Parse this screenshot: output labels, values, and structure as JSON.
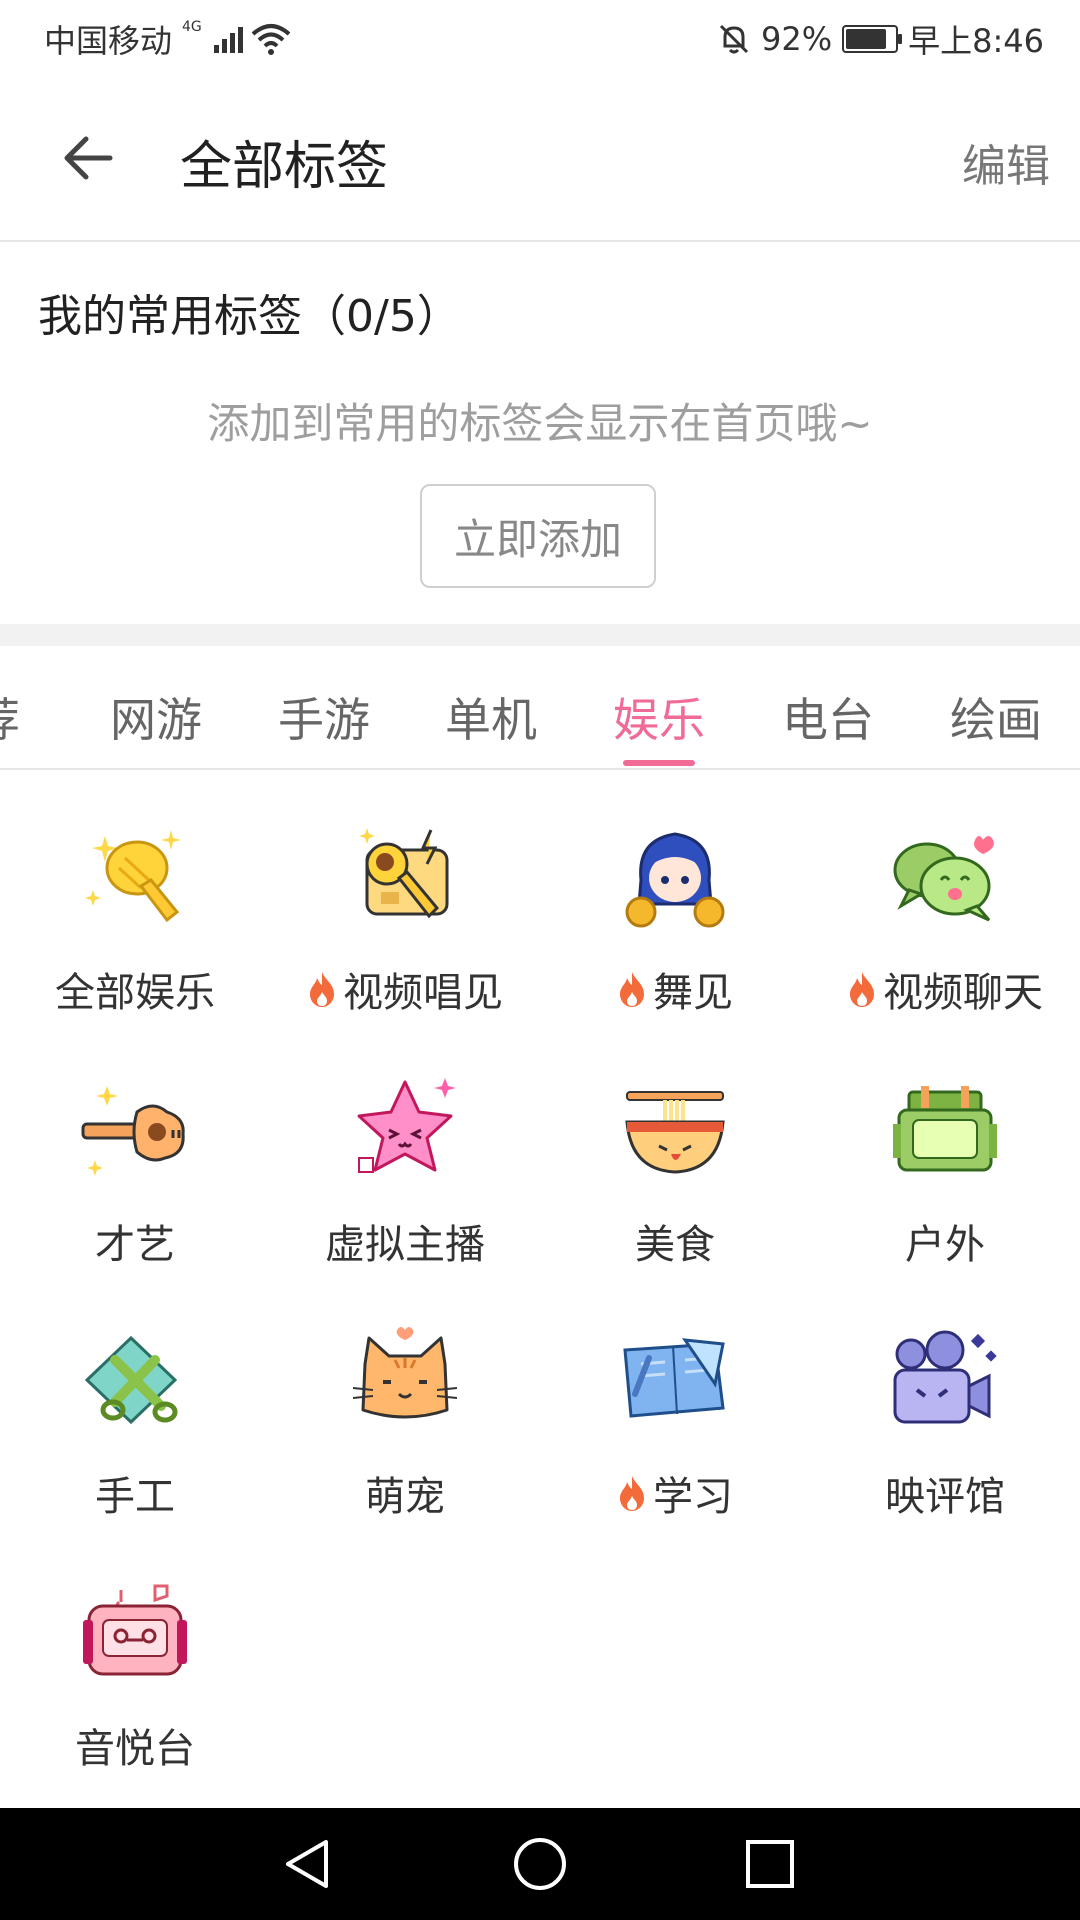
{
  "status_bar": {
    "carrier": "中国移动",
    "network": "4G",
    "battery": "92%",
    "battery_level": 0.92,
    "time": "早上8:46"
  },
  "header": {
    "title": "全部标签",
    "edit_label": "编辑",
    "back_icon": "arrow-left-icon"
  },
  "common_tags": {
    "title": "我的常用标签（0/5）",
    "hint": "添加到常用的标签会显示在首页哦~",
    "add_button": "立即添加"
  },
  "tabs": [
    {
      "label": "荐"
    },
    {
      "label": "网游"
    },
    {
      "label": "手游"
    },
    {
      "label": "单机"
    },
    {
      "label": "娱乐",
      "active": true
    },
    {
      "label": "电台"
    },
    {
      "label": "绘画"
    }
  ],
  "items": [
    {
      "label": "全部娱乐",
      "hot": false,
      "icon": "microphone-icon"
    },
    {
      "label": "视频唱见",
      "hot": true,
      "icon": "microphone-screen-icon"
    },
    {
      "label": "舞见",
      "hot": true,
      "icon": "dancer-girl-icon"
    },
    {
      "label": "视频聊天",
      "hot": true,
      "icon": "chat-bubbles-icon"
    },
    {
      "label": "才艺",
      "hot": false,
      "icon": "guitar-icon"
    },
    {
      "label": "虚拟主播",
      "hot": false,
      "icon": "pink-star-icon"
    },
    {
      "label": "美食",
      "hot": false,
      "icon": "noodle-bowl-icon"
    },
    {
      "label": "户外",
      "hot": false,
      "icon": "backpack-icon"
    },
    {
      "label": "手工",
      "hot": false,
      "icon": "scissors-icon"
    },
    {
      "label": "萌宠",
      "hot": true,
      "icon": "cat-icon"
    },
    {
      "label": "学习",
      "hot": true,
      "icon": "ruler-notebook-icon"
    },
    {
      "label": "映评馆",
      "hot": false,
      "icon": "film-camera-icon"
    },
    {
      "label": "音悦台",
      "hot": false,
      "icon": "radio-icon"
    }
  ],
  "colors": {
    "accent": "#f06b95",
    "fire": "#f36b3b"
  },
  "nav": {
    "back_icon": "triangle-back-icon",
    "home_icon": "circle-home-icon",
    "recent_icon": "square-recent-icon"
  }
}
